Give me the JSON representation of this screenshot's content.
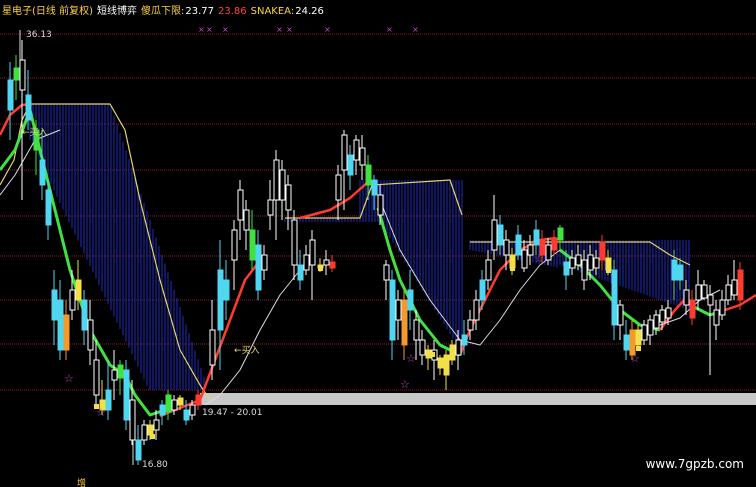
{
  "colors": {
    "bg": "#000000",
    "grid": "#8a1c2a",
    "up": "#ffffff",
    "down_cyan": "#4fd6f0",
    "green_line": "#3fe23f",
    "red_line": "#ff3b2f",
    "white_line": "#dcdcdc",
    "yellow_line": "#e8d36a",
    "fill_blue": "#1f2bc0",
    "header_label": "#ffd23f",
    "header_value": "#ffffff",
    "header_red": "#ff4040",
    "marker_purple": "#c24ac0"
  },
  "header": {
    "title": "星电子(日线 前复权)",
    "indicator": "短线博弈",
    "line1_label": "傻瓜下限:",
    "line1_value": "23.77",
    "line2_value": "23.86",
    "line3_label": "SNAKEA:",
    "line3_value": "24.26"
  },
  "annotations": {
    "high_label": "36.13",
    "low_label": "16.80",
    "buy1": "买入",
    "buy2": "买入",
    "mid_label": "19.47 - 20.01",
    "bottom_tag": "增",
    "watermark": "www.7gpzb.com"
  },
  "chart_data": {
    "type": "candlestick",
    "ylim": [
      15.5,
      37.5
    ],
    "grid": true,
    "high": 36.13,
    "low": 16.8,
    "series": [
      {
        "kind": "green_line"
      },
      {
        "kind": "red_line"
      },
      {
        "kind": "white_line"
      },
      {
        "kind": "yellow_line"
      }
    ]
  }
}
